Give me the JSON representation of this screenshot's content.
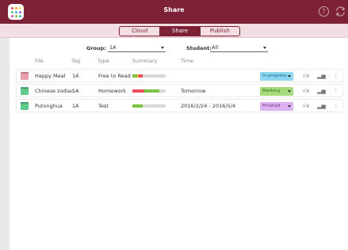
{
  "window": {
    "title": "Share"
  },
  "icons": {
    "apps": "apps-grid-icon",
    "help": "help-icon",
    "sync": "sync-icon"
  },
  "help_glyph": "?",
  "tabs": [
    {
      "label": "Cloud",
      "active": false
    },
    {
      "label": "Share",
      "active": true
    },
    {
      "label": "Publish",
      "active": false
    }
  ],
  "filters": {
    "group": {
      "label": "Group:",
      "value": "1A"
    },
    "student": {
      "label": "Student:",
      "value": "All"
    }
  },
  "columns": {
    "file": "File",
    "tag": "Tag",
    "type": "Type",
    "summary": "Summary",
    "time": "Time"
  },
  "rows": [
    {
      "file": "Happy Meal",
      "tag": "1A",
      "type": "Free to Read",
      "time": "",
      "icon_color": "#e8a0ad",
      "summary": [
        {
          "color": "#7cc242",
          "value": 0.15
        },
        {
          "color": "#f5a623",
          "value": 0.05
        },
        {
          "color": "#e8505b",
          "value": 0.1
        }
      ],
      "status": {
        "label": "In progress",
        "color": "#8dd8f0",
        "text_color": "#1a5f8c"
      },
      "actions": {
        "check": "√x",
        "chart": "▂▅",
        "more": "⋮"
      }
    },
    {
      "file": "Chinese zodiac",
      "tag": "1A",
      "type": "Homework",
      "time": "Tomorrow",
      "icon_color": "#5ecb8a",
      "summary": [
        {
          "color": "#e8505b",
          "value": 0.35
        },
        {
          "color": "#7cc242",
          "value": 0.45
        }
      ],
      "status": {
        "label": "Marking",
        "color": "#a6db7c",
        "text_color": "#3b6a18"
      },
      "actions": {
        "check": "√x",
        "chart": "▂▅",
        "more": "⋮"
      }
    },
    {
      "file": "Putonghua",
      "tag": "1A",
      "type": "Test",
      "time": "2016/2/24 - 2016/5/4",
      "icon_color": "#5ecb8a",
      "summary": [
        {
          "color": "#7cc242",
          "value": 0.3
        }
      ],
      "status": {
        "label": "Finished",
        "color": "#dcb3f0",
        "text_color": "#6b2f86"
      },
      "actions": {
        "check": "√x",
        "chart": "▂▅",
        "more": "⋮"
      }
    }
  ],
  "colors": {
    "brand": "#7d2236",
    "subbar": "#f3dfe3",
    "background": "#e8e8e8"
  }
}
